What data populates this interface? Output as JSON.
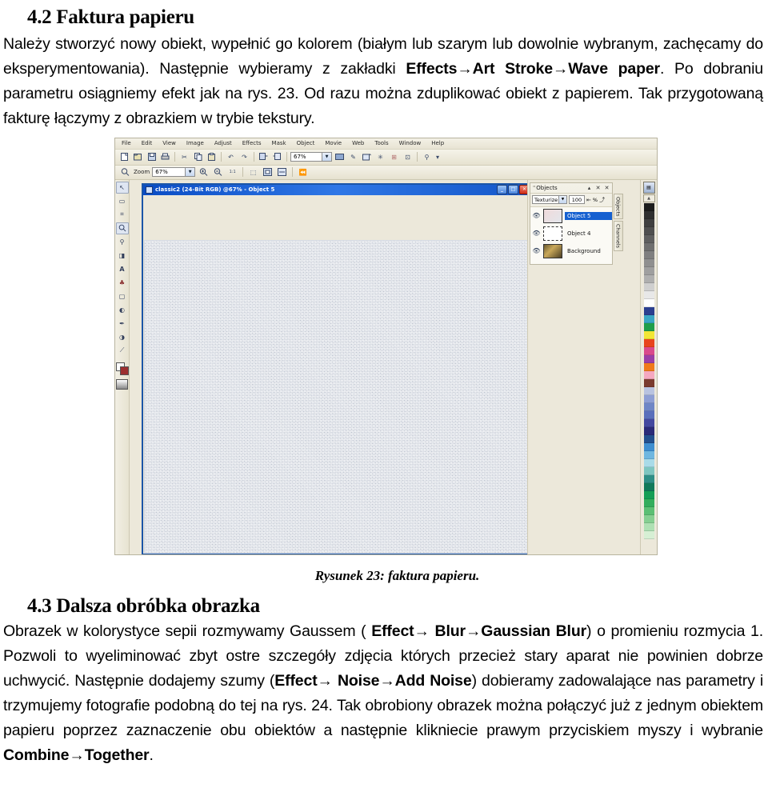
{
  "document": {
    "section1": {
      "number_title": "4.2 Faktura papieru",
      "paragraph_runs": [
        {
          "t": "Należy stworzyć nowy obiekt, wypełnić go kolorem (białym lub szarym lub dowolnie wybranym, zachęcamy do eksperymentowania). Następnie wybieramy z zakładki ",
          "b": false
        },
        {
          "t": "Effects→Art Stroke→Wave paper",
          "b": true
        },
        {
          "t": ". Po dobraniu parametru osiągniemy efekt jak na rys. 23. Od razu można zduplikować obiekt z papierem. Tak przygotowaną fakturę łączymy z obrazkiem w trybie tekstury.",
          "b": false
        }
      ]
    },
    "figure_caption": "Rysunek 23: faktura papieru.",
    "section2": {
      "number_title": "4.3 Dalsza obróbka obrazka",
      "paragraph_runs": [
        {
          "t": "Obrazek w kolorystyce sepii rozmywamy Gaussem ( ",
          "b": false
        },
        {
          "t": "Effect→ Blur→Gaussian Blur",
          "b": true
        },
        {
          "t": ") o promieniu rozmycia 1. Pozwoli to wyeliminować zbyt ostre szczegóły zdjęcia których przecież stary aparat nie powinien dobrze uchwycić. Następnie dodajemy szumy (",
          "b": false
        },
        {
          "t": "Effect→ Noise→Add Noise",
          "b": true
        },
        {
          "t": ") dobieramy zadowalające nas parametry i trzymujemy fotografie podobną do tej na rys. 24. Tak obrobiony obrazek można połączyć już z jednym obiektem papieru poprzez zaznaczenie obu obiektów a następnie klikniecie prawym przyciskiem myszy i wybranie ",
          "b": false
        },
        {
          "t": "Combine→Together",
          "b": true
        },
        {
          "t": ".",
          "b": false
        }
      ]
    }
  },
  "screenshot": {
    "menubar": [
      "File",
      "Edit",
      "View",
      "Image",
      "Adjust",
      "Effects",
      "Mask",
      "Object",
      "Movie",
      "Web",
      "Tools",
      "Window",
      "Help"
    ],
    "toolbar": {
      "zoom_combo_value": "67%",
      "buttons": [
        {
          "name": "new-file-icon",
          "glyph": "🗋"
        },
        {
          "name": "open-file-icon",
          "glyph": "🗀"
        },
        {
          "name": "save-file-icon",
          "glyph": "🖫"
        },
        {
          "name": "print-icon",
          "glyph": "🖨"
        },
        {
          "name": "cut-icon",
          "glyph": "✂"
        },
        {
          "name": "copy-icon",
          "glyph": "⧉"
        },
        {
          "name": "paste-icon",
          "glyph": "📋"
        },
        {
          "name": "undo-icon",
          "glyph": "↶"
        },
        {
          "name": "redo-icon",
          "glyph": "↷"
        },
        {
          "name": "import-icon",
          "glyph": "⬓"
        },
        {
          "name": "export-icon",
          "glyph": "⬒"
        }
      ],
      "buttons_right": [
        {
          "name": "fullscreen-icon",
          "glyph": "🖵"
        },
        {
          "name": "color-mask-icon",
          "glyph": "✎"
        },
        {
          "name": "crop-export-icon",
          "glyph": "⬔"
        },
        {
          "name": "web-image-icon",
          "glyph": "✳"
        },
        {
          "name": "corel-capture-icon",
          "glyph": "⊞"
        },
        {
          "name": "app-launcher-icon",
          "glyph": "⊡"
        },
        {
          "name": "help-what-icon",
          "glyph": "⚲"
        }
      ]
    },
    "propertybar": {
      "tool_label": "Zoom",
      "zoom_value": "67%",
      "buttons": [
        {
          "name": "zoom-in-icon",
          "glyph": "⊕"
        },
        {
          "name": "zoom-out-icon",
          "glyph": "⊖"
        },
        {
          "name": "zoom-100-icon",
          "glyph": "1:1"
        },
        {
          "name": "zoom-to-selection-icon",
          "glyph": "⬚"
        },
        {
          "name": "zoom-to-fit-icon",
          "glyph": "⤢"
        },
        {
          "name": "zoom-to-width-icon",
          "glyph": "⬌"
        },
        {
          "name": "zoom-reset-icon",
          "glyph": "⏪"
        }
      ]
    },
    "toolbox": [
      {
        "name": "pick-tool",
        "glyph": "↖"
      },
      {
        "name": "mask-rect-tool",
        "glyph": "▭"
      },
      {
        "name": "crop-tool",
        "glyph": "⌗"
      },
      {
        "name": "zoom-tool",
        "glyph": "⌕"
      },
      {
        "name": "eyedropper-tool",
        "glyph": "⚲"
      },
      {
        "name": "eraser-tool",
        "glyph": "◨"
      },
      {
        "name": "text-tool",
        "glyph": "A"
      },
      {
        "name": "clone-tool",
        "glyph": "♣"
      },
      {
        "name": "rectangle-tool",
        "glyph": "▢"
      },
      {
        "name": "fill-tool",
        "glyph": "◐"
      },
      {
        "name": "paint-tool",
        "glyph": "✒"
      },
      {
        "name": "effect-tool",
        "glyph": "◑"
      },
      {
        "name": "interactive-tool",
        "glyph": "⟋"
      }
    ],
    "image_window": {
      "title": "classic2 (24-Bit RGB) @67% - Object 5",
      "minimize_label": "_",
      "maximize_label": "□",
      "close_label": "✕"
    },
    "objects_docker": {
      "grip": "\"",
      "title": "Objects",
      "collapse_label": "▴",
      "close_label": "✕",
      "hide_label": "✕",
      "blend_mode": "Texturize",
      "opacity": "100",
      "percent_label": "%",
      "lock_icon_name": "lock-transparency-icon",
      "layers": [
        {
          "name": "Object 5",
          "selected": true,
          "visible": true,
          "thumb": "t1"
        },
        {
          "name": "Object 4",
          "selected": false,
          "visible": true,
          "thumb": "t2"
        },
        {
          "name": "Background",
          "selected": false,
          "visible": true,
          "thumb": "t3"
        }
      ]
    },
    "docker_tabs": [
      "Objects",
      "Channels"
    ],
    "palette": {
      "colors": [
        "#1c1c1c",
        "#2f2f2f",
        "#3f3f3f",
        "#4f4f4f",
        "#5f5f5f",
        "#6f6f6f",
        "#7f7f7f",
        "#8f8f8f",
        "#9f9f9f",
        "#afafaf",
        "#cfcfcf",
        "#e8e8e8",
        "#ffffff",
        "#2b3f8f",
        "#3aa6c4",
        "#1f9e4a",
        "#f2e636",
        "#e8441c",
        "#d94a8c",
        "#9b3fa6",
        "#f07a1a",
        "#f5a8c0",
        "#7a3b2e",
        "#b9c3e0",
        "#8e9ed4",
        "#6f86c6",
        "#5a6fbb",
        "#44489f",
        "#2b2b78",
        "#23508e",
        "#3f8fd0",
        "#6fb7e0",
        "#a9dbe8",
        "#7ec6c0",
        "#2f8f86",
        "#117a5a",
        "#159e55",
        "#33ad5c",
        "#5cbf74",
        "#86cf92",
        "#aee0b3",
        "#d6efd4"
      ]
    }
  }
}
